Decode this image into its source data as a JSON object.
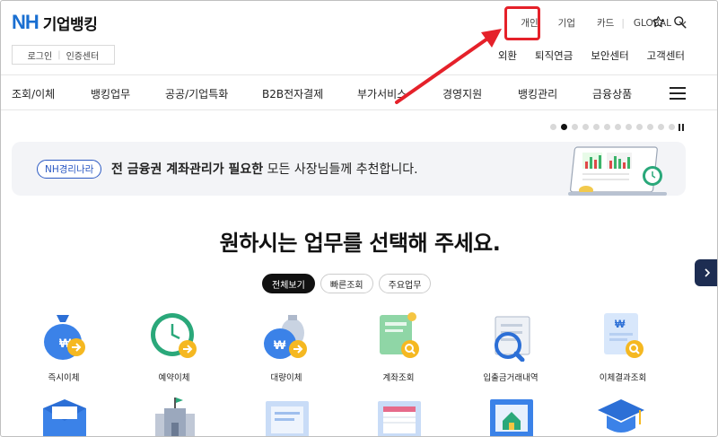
{
  "header": {
    "logo_nh": "NH",
    "logo_name": "기업뱅킹",
    "login": "로그인",
    "cert": "인증센터",
    "top_items": [
      "개인",
      "기업",
      "카드"
    ],
    "global": "GLOBAL",
    "sub_items": [
      "외환",
      "퇴직연금",
      "보안센터",
      "고객센터"
    ]
  },
  "gnb": {
    "items": [
      "조회/이체",
      "뱅킹업무",
      "공공/기업특화",
      "B2B전자결제",
      "부가서비스",
      "경영지원",
      "뱅킹관리",
      "금융상품"
    ]
  },
  "banner": {
    "pill": "NH경리나라",
    "bold_text": "전 금융권 계좌관리가 필요한",
    "rest_text": " 모든 사장님들께 추천합니다."
  },
  "carousel": {
    "total": 12,
    "active": 2
  },
  "main": {
    "heading": "원하시는 업무를 선택해 주세요.",
    "tabs": [
      "전체보기",
      "빠른조회",
      "주요업무"
    ]
  },
  "services": [
    {
      "label": "즉시이체",
      "icon": "money-bag-transfer-icon"
    },
    {
      "label": "예약이체",
      "icon": "clock-transfer-icon"
    },
    {
      "label": "대량이체",
      "icon": "money-bags-transfer-icon"
    },
    {
      "label": "계좌조회",
      "icon": "account-search-icon"
    },
    {
      "label": "입출금거래내역",
      "icon": "transaction-history-icon"
    },
    {
      "label": "이체결과조회",
      "icon": "transfer-result-search-icon"
    }
  ],
  "colors": {
    "brand_blue": "#1a6fd1",
    "highlight_red": "#e5212a",
    "nav_dark": "#1d2d52"
  }
}
